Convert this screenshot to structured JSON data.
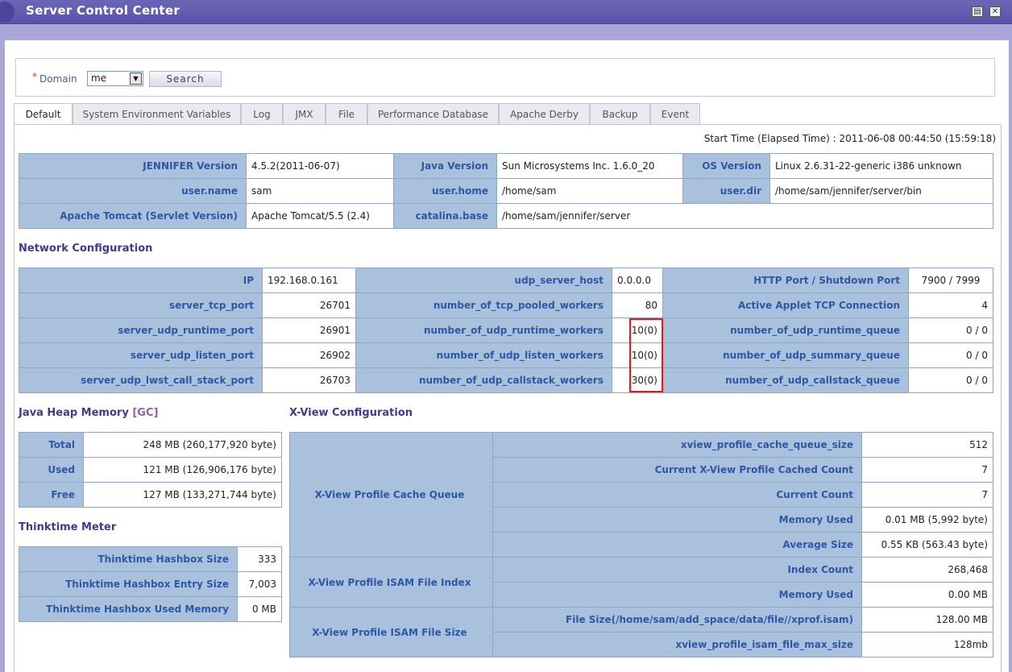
{
  "window": {
    "title": "Server Control Center"
  },
  "search": {
    "domain_label": "Domain",
    "domain_value": "me",
    "button": "Search"
  },
  "tabs": [
    "Default",
    "System Environment Variables",
    "Log",
    "JMX",
    "File",
    "Performance Database",
    "Apache Derby",
    "Backup",
    "Event"
  ],
  "start_time": "Start Time (Elapsed Time) : 2011-06-08 00:44:50 (15:59:18)",
  "version_table": [
    [
      "JENNIFER Version",
      "4.5.2(2011-06-07)",
      "Java Version",
      "Sun Microsystems Inc. 1.6.0_20",
      "OS Version",
      "Linux 2.6.31-22-generic i386 unknown"
    ],
    [
      "user.name",
      "sam",
      "user.home",
      "/home/sam",
      "user.dir",
      "/home/sam/jennifer/server/bin"
    ],
    [
      "Apache Tomcat (Servlet Version)",
      "Apache Tomcat/5.5 (2.4)",
      "catalina.base",
      "/home/sam/jennifer/server"
    ]
  ],
  "network": {
    "title": "Network Configuration",
    "rows": [
      [
        "IP",
        "192.168.0.161",
        "udp_server_host",
        "0.0.0.0",
        "HTTP Port / Shutdown Port",
        "7900 / 7999"
      ],
      [
        "server_tcp_port",
        "26701",
        "number_of_tcp_pooled_workers",
        "80",
        "Active Applet TCP Connection",
        "4"
      ],
      [
        "server_udp_runtime_port",
        "26901",
        "number_of_udp_runtime_workers",
        "10(0)",
        "number_of_udp_runtime_queue",
        "0 / 0"
      ],
      [
        "server_udp_listen_port",
        "26902",
        "number_of_udp_listen_workers",
        "10(0)",
        "number_of_udp_summary_queue",
        "0 / 0"
      ],
      [
        "server_udp_lwst_call_stack_port",
        "26703",
        "number_of_udp_callstack_workers",
        "30(0)",
        "number_of_udp_callstack_queue",
        "0 / 0"
      ]
    ]
  },
  "heap": {
    "title": "Java Heap Memory",
    "gc_link": "[GC]",
    "rows": [
      [
        "Total",
        "248 MB (260,177,920 byte)"
      ],
      [
        "Used",
        "121 MB (126,906,176 byte)"
      ],
      [
        "Free",
        "127 MB (133,271,744 byte)"
      ]
    ]
  },
  "thinktime": {
    "title": "Thinktime Meter",
    "rows": [
      [
        "Thinktime Hashbox Size",
        "333"
      ],
      [
        "Thinktime Hashbox Entry Size",
        "7,003"
      ],
      [
        "Thinktime Hashbox Used Memory",
        "0 MB"
      ]
    ]
  },
  "xview": {
    "title": "X-View Configuration",
    "groups": [
      {
        "name": "X-View Profile Cache Queue",
        "rows": [
          [
            "xview_profile_cache_queue_size",
            "512"
          ],
          [
            "Current X-View Profile Cached Count",
            "7"
          ],
          [
            "Current Count",
            "7"
          ],
          [
            "Memory Used",
            "0.01 MB (5,992 byte)"
          ],
          [
            "Average Size",
            "0.55 KB (563.43 byte)"
          ]
        ]
      },
      {
        "name": "X-View Profile ISAM File Index",
        "rows": [
          [
            "Index Count",
            "268,468"
          ],
          [
            "Memory Used",
            "0.00 MB"
          ]
        ]
      },
      {
        "name": "X-View Profile ISAM File Size",
        "rows": [
          [
            "File Size(/home/sam/add_space/data/file//xprof.isam)",
            "128.00 MB"
          ],
          [
            "xview_profile_isam_file_max_size",
            "128mb"
          ]
        ]
      }
    ]
  }
}
